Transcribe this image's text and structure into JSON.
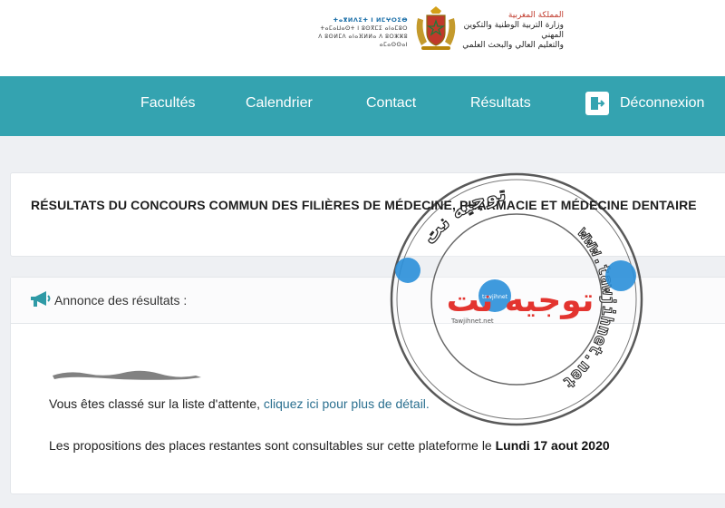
{
  "header": {
    "tifinagh_lines": [
      "ⵜⴰⴳⵍⴷⵉⵜ ⵏ ⵍⵎⵖⵔⵉⴱ",
      "ⵜⴰⵎⴰⵡⴰⵙⵜ ⵏ ⵓⵙⴳⵎⵉ ⴰⵏⴰⵎⵓⵔ",
      "ⴷ ⵓⵙⵍⵎⴷ ⴰⵏⴰⴼⵍⵍⴰ ⴷ ⵓⵔⵣⵣⵓ ⴰⵎⴰⵙⵙⴰⵏ"
    ],
    "arabic_lines": [
      "المملكة المغربية",
      "وزارة التربية الوطنية والتكوين المهني",
      "والتعليم العالي والبحث العلمي"
    ]
  },
  "nav": {
    "items": [
      "Facultés",
      "Calendrier",
      "Contact",
      "Résultats"
    ],
    "logout_label": "Déconnexion"
  },
  "page": {
    "title": "RÉSULTATS DU CONCOURS COMMUN DES FILIÈRES DE MÉDECINE, PHARMACIE ET MÉDECINE DENTAIRE"
  },
  "announcement": {
    "heading": "Annonce des résultats :",
    "status_text": "Vous êtes classé sur la liste d'attente, ",
    "link_text": "cliquez ici pour plus de détail.",
    "info_text": "Les propositions des places restantes sont consultables sur cette plateforme le ",
    "info_date": "Lundi 17 aout 2020"
  },
  "watermark": {
    "brand_ar": "توجيه نت",
    "url": "www.tawjihnet.net",
    "small": "Tawjihnet.net",
    "bubble": "tawjihnet"
  },
  "colors": {
    "nav_bg": "#34a3b0",
    "link": "#2a6f8f",
    "watermark_red": "#e3342f",
    "watermark_blue": "#2a8fd9"
  }
}
